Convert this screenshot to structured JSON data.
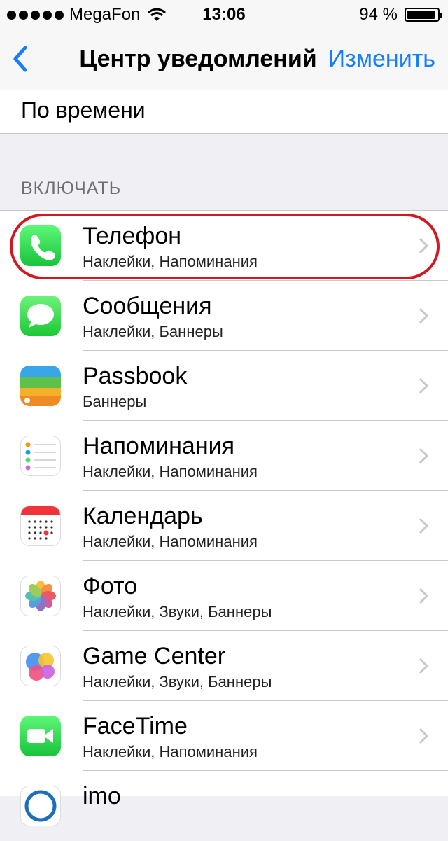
{
  "status_bar": {
    "carrier": "MegaFon",
    "time": "13:06",
    "battery_percent": "94 %",
    "battery_level": 0.94
  },
  "nav": {
    "back_icon": "chevron-left-icon",
    "title": "Центр уведомлений",
    "edit_label": "Изменить",
    "accent_color": "#147efb"
  },
  "sort_option": "По времени",
  "section_header": "ВКЛЮЧАТЬ",
  "highlight_color": "#d21922",
  "apps": [
    {
      "name": "Телефон",
      "detail": "Наклейки, Напоминания",
      "icon": "phone-icon"
    },
    {
      "name": "Сообщения",
      "detail": "Наклейки, Баннеры",
      "icon": "messages-icon"
    },
    {
      "name": "Passbook",
      "detail": "Баннеры",
      "icon": "passbook-icon"
    },
    {
      "name": "Напоминания",
      "detail": "Наклейки, Напоминания",
      "icon": "reminders-icon"
    },
    {
      "name": "Календарь",
      "detail": "Наклейки, Напоминания",
      "icon": "calendar-icon"
    },
    {
      "name": "Фото",
      "detail": "Наклейки, Звуки, Баннеры",
      "icon": "photos-icon"
    },
    {
      "name": "Game Center",
      "detail": "Наклейки, Звуки, Баннеры",
      "icon": "game-center-icon"
    },
    {
      "name": "FaceTime",
      "detail": "Наклейки, Напоминания",
      "icon": "facetime-icon"
    },
    {
      "name": "imo",
      "detail": "",
      "icon": "imo-icon"
    }
  ]
}
